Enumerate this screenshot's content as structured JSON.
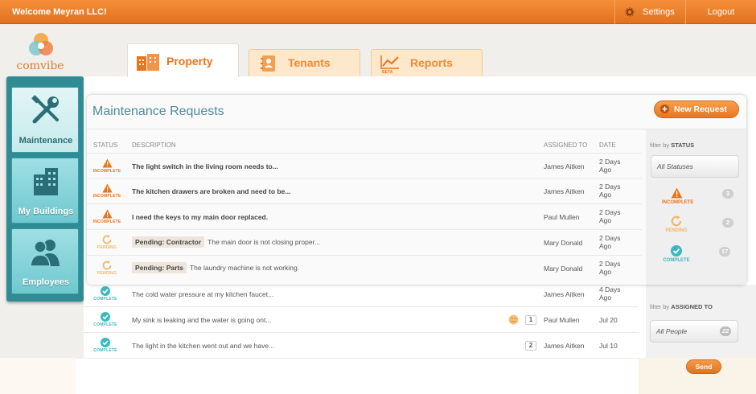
{
  "header": {
    "welcome": "Welcome Meyran LLC!",
    "settings": "Settings",
    "logout": "Logout"
  },
  "logo": {
    "text": "comvibe"
  },
  "sidebar": {
    "items": [
      {
        "label": "Maintenance"
      },
      {
        "label": "My Buildings"
      },
      {
        "label": "Employees"
      }
    ]
  },
  "tabs": [
    {
      "label": "Property"
    },
    {
      "label": "Tenants"
    },
    {
      "label": "Reports",
      "badge": "BETA"
    }
  ],
  "panel": {
    "title": "Maintenance Requests",
    "new_request": "New Request"
  },
  "columns": {
    "status": "STATUS",
    "description": "DESCRIPTION",
    "assigned": "ASSIGNED TO",
    "date": "DATE"
  },
  "rows": [
    {
      "status": "INCOMPLETE",
      "tag": "",
      "desc": "The light switch in the living room needs to...",
      "assigned": "James Aitken",
      "date": "2 Days Ago"
    },
    {
      "status": "INCOMPLETE",
      "tag": "",
      "desc": "The kitchen drawers are broken and need to be...",
      "assigned": "James Aitken",
      "date": "2 Days Ago"
    },
    {
      "status": "INCOMPLETE",
      "tag": "",
      "desc": "I need the keys to my main door replaced.",
      "assigned": "Paul Mullen",
      "date": "2 Days Ago"
    },
    {
      "status": "PENDING",
      "tag": "Pending: Contractor",
      "desc": "The main door is not closing proper...",
      "assigned": "Mary Donald",
      "date": "2 Days Ago"
    },
    {
      "status": "PENDING",
      "tag": "Pending: Parts",
      "desc": "The laundry machine is not working.",
      "assigned": "Mary Donald",
      "date": "2 Days Ago"
    }
  ],
  "outer_rows": [
    {
      "status": "COMPLETE",
      "desc": "The cold water pressure at my kitchen faucet...",
      "assigned": "James Aitken",
      "date": "4 Days Ago",
      "count": ""
    },
    {
      "status": "COMPLETE",
      "desc": "My sink is leaking and the water is going ont...",
      "assigned": "Paul Mullen",
      "date": "Jul 20",
      "count": "1"
    },
    {
      "status": "COMPLETE",
      "desc": "The light in the kitchen went out and we have...",
      "assigned": "James Aitken",
      "date": "Jul 10",
      "count": "2"
    }
  ],
  "filters": {
    "status_label_pre": "filter by",
    "status_label": "STATUS",
    "all_statuses": "All Statuses",
    "items": [
      {
        "label": "INCOMPLETE",
        "count": "3"
      },
      {
        "label": "PENDING",
        "count": "2"
      },
      {
        "label": "COMPLETE",
        "count": "17"
      }
    ],
    "assigned_label_pre": "filter by",
    "assigned_label": "ASSIGNED TO",
    "all_people": "All People",
    "all_people_count": "22"
  },
  "compose": {
    "send": "Send"
  },
  "colors": {
    "accent": "#e8741c",
    "teal": "#2f8c95",
    "incomplete": "#e8741c",
    "pending": "#f2b66a",
    "complete": "#3bb8c0"
  }
}
